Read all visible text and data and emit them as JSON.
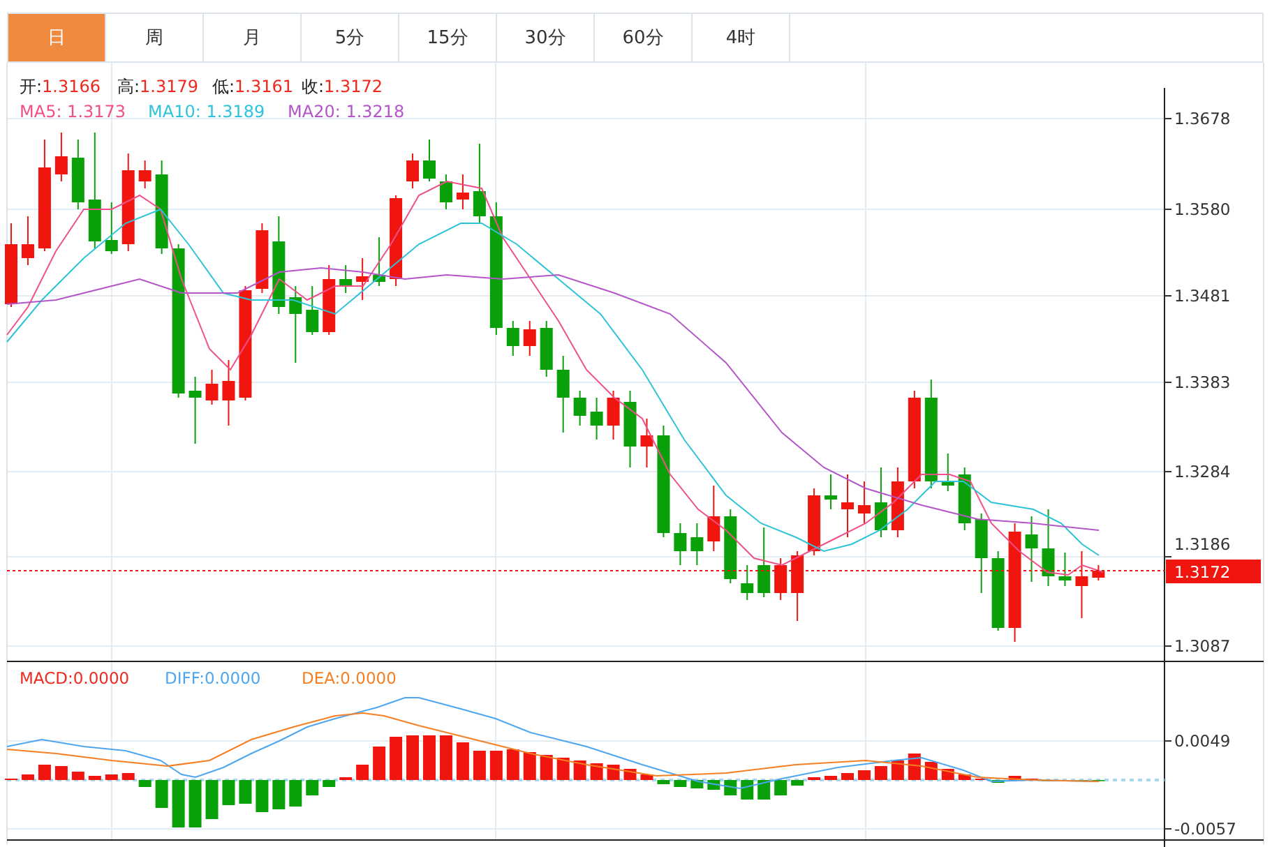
{
  "tabs": [
    {
      "label": "日",
      "selected": true
    },
    {
      "label": "周",
      "selected": false
    },
    {
      "label": "月",
      "selected": false
    },
    {
      "label": "5分",
      "selected": false
    },
    {
      "label": "15分",
      "selected": false
    },
    {
      "label": "30分",
      "selected": false
    },
    {
      "label": "60分",
      "selected": false
    },
    {
      "label": "4时",
      "selected": false
    }
  ],
  "quote": [
    {
      "label": "开:",
      "value": "1.3166"
    },
    {
      "label": "高:",
      "value": "1.3179"
    },
    {
      "label": "低:",
      "value": "1.3161"
    },
    {
      "label": "收:",
      "value": "1.3172"
    }
  ],
  "moving_averages": [
    {
      "label": "MA5:",
      "value": "1.3173",
      "color": "#f0508a"
    },
    {
      "label": "MA10:",
      "value": "1.3189",
      "color": "#2ec3d8"
    },
    {
      "label": "MA20:",
      "value": "1.3218",
      "color": "#b455c8"
    }
  ],
  "price_axis": [
    "1.3678",
    "1.3580",
    "1.3481",
    "1.3383",
    "1.3284",
    "1.3186",
    "1.3087"
  ],
  "current_price": "1.3172",
  "macd_legend": [
    {
      "label": "MACD:",
      "value": "0.0000",
      "color": "#f0281e"
    },
    {
      "label": "DIFF:",
      "value": "0.0000",
      "color": "#4da6f0"
    },
    {
      "label": "DEA:",
      "value": "0.0000",
      "color": "#f57f22"
    }
  ],
  "macd_axis": [
    "0.0049",
    "-0.0057"
  ]
}
